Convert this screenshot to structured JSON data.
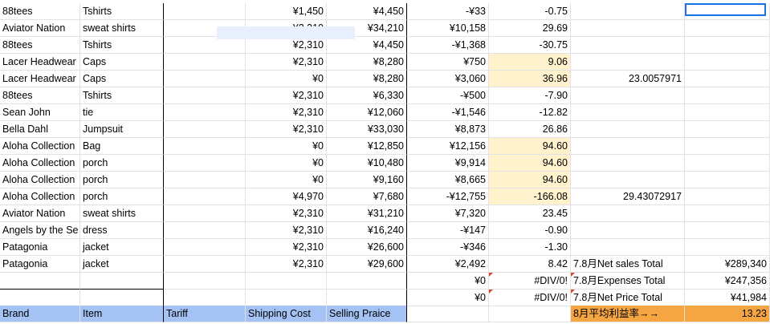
{
  "rows": [
    {
      "brand": "88tees",
      "item": "Tshirts",
      "tariff": "",
      "shipping": "¥1,450",
      "selling": "¥4,450",
      "g": "-¥33",
      "h": "-0.75",
      "i": "",
      "j": ""
    },
    {
      "brand": "Aviator Nation",
      "item": "sweat shirts",
      "tariff": "",
      "shipping": "¥2,310",
      "selling": "¥34,210",
      "g": "¥10,158",
      "h": "29.69",
      "i": "",
      "j": ""
    },
    {
      "brand": "88tees",
      "item": "Tshirts",
      "tariff": "",
      "shipping": "¥2,310",
      "selling": "¥4,450",
      "g": "-¥1,368",
      "h": "-30.75",
      "i": "",
      "j": ""
    },
    {
      "brand": "Lacer Headwear",
      "item": "Caps",
      "tariff": "",
      "shipping": "¥2,310",
      "selling": "¥8,280",
      "g": "¥750",
      "h": "9.06",
      "i": "",
      "j": ""
    },
    {
      "brand": "Lacer Headwear",
      "item": "Caps",
      "tariff": "",
      "shipping": "¥0",
      "selling": "¥8,280",
      "g": "¥3,060",
      "h": "36.96",
      "i": "23.0057971",
      "j": ""
    },
    {
      "brand": "88tees",
      "item": "Tshirts",
      "tariff": "",
      "shipping": "¥2,310",
      "selling": "¥6,330",
      "g": "-¥500",
      "h": "-7.90",
      "i": "",
      "j": ""
    },
    {
      "brand": "Sean John",
      "item": "tie",
      "tariff": "",
      "shipping": "¥2,310",
      "selling": "¥12,060",
      "g": "-¥1,546",
      "h": "-12.82",
      "i": "",
      "j": ""
    },
    {
      "brand": "Bella Dahl",
      "item": "Jumpsuit",
      "tariff": "",
      "shipping": "¥2,310",
      "selling": "¥33,030",
      "g": "¥8,873",
      "h": "26.86",
      "i": "",
      "j": ""
    },
    {
      "brand": "Aloha Collection",
      "item": "Bag",
      "tariff": "",
      "shipping": "¥0",
      "selling": "¥12,850",
      "g": "¥12,156",
      "h": "94.60",
      "i": "",
      "j": ""
    },
    {
      "brand": "Aloha Collection",
      "item": "porch",
      "tariff": "",
      "shipping": "¥0",
      "selling": "¥10,480",
      "g": "¥9,914",
      "h": "94.60",
      "i": "",
      "j": ""
    },
    {
      "brand": "Aloha Collection",
      "item": "porch",
      "tariff": "",
      "shipping": "¥0",
      "selling": "¥9,160",
      "g": "¥8,665",
      "h": "94.60",
      "i": "",
      "j": ""
    },
    {
      "brand": "Aloha Collection",
      "item": "porch",
      "tariff": "",
      "shipping": "¥4,970",
      "selling": "¥7,680",
      "g": "-¥12,755",
      "h": "-166.08",
      "i": "29.43072917",
      "j": ""
    },
    {
      "brand": "Aviator Nation",
      "item": "sweat shirts",
      "tariff": "",
      "shipping": "¥2,310",
      "selling": "¥31,210",
      "g": "¥7,320",
      "h": "23.45",
      "i": "",
      "j": ""
    },
    {
      "brand": "Angels by the Se",
      "item": "dress",
      "tariff": "",
      "shipping": "¥2,310",
      "selling": "¥16,240",
      "g": "-¥147",
      "h": "-0.90",
      "i": "",
      "j": ""
    },
    {
      "brand": "Patagonia",
      "item": "jacket",
      "tariff": "",
      "shipping": "¥2,310",
      "selling": "¥26,600",
      "g": "-¥346",
      "h": "-1.30",
      "i": "",
      "j": ""
    },
    {
      "brand": "Patagonia",
      "item": "jacket",
      "tariff": "",
      "shipping": "¥2,310",
      "selling": "¥29,600",
      "g": "¥2,492",
      "h": "8.42",
      "i": "7.8月Net sales Total",
      "j": "¥289,340"
    },
    {
      "brand": "",
      "item": "",
      "tariff": "",
      "shipping": "",
      "selling": "",
      "g": "¥0",
      "h": "#DIV/0!",
      "i": "7.8月Expenses Total",
      "j": "¥247,356"
    },
    {
      "brand": "",
      "item": "",
      "tariff": "",
      "shipping": "",
      "selling": "",
      "g": "¥0",
      "h": "#DIV/0!",
      "i": "7.8月Net Price Total",
      "j": "¥41,984"
    }
  ],
  "header": {
    "brand": "Brand",
    "item": "Item",
    "tariff": "Tariff",
    "shipping": "Shipping Cost",
    "selling": "Selling Praice",
    "summary_label": "8月平均利益率→→",
    "summary_value": "13.23"
  },
  "colors": {
    "highlight": "#fff2cc",
    "header": "#a4c2f4",
    "summary": "#f6a543",
    "selection": "#1a73e8"
  }
}
